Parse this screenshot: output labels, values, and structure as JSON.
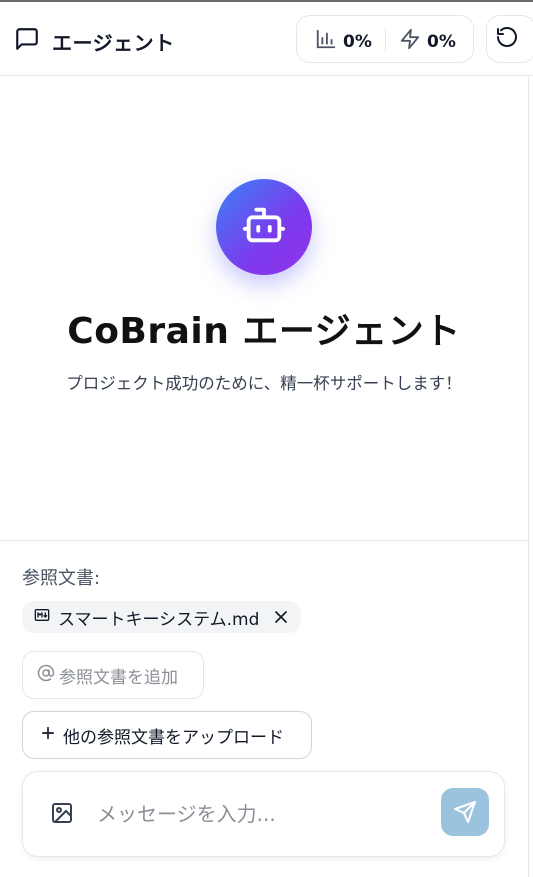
{
  "header": {
    "title": "エージェント",
    "stats": [
      {
        "icon": "bar-chart-icon",
        "value": "0%"
      },
      {
        "icon": "lightning-icon",
        "value": "0%"
      }
    ],
    "reset_icon": "reset-icon"
  },
  "hero": {
    "avatar_icon": "robot-icon",
    "title": "CoBrain エージェント",
    "subtitle": "プロジェクト成功のために、精一杯サポートします！"
  },
  "references": {
    "label": "参照文書:",
    "documents": [
      {
        "name": "スマートキーシステム.md",
        "icon": "markdown-icon"
      }
    ],
    "add_label": "参照文書を追加",
    "upload_label": "他の参照文書をアップロード"
  },
  "composer": {
    "placeholder": "メッセージを入力...",
    "image_icon": "image-icon",
    "send_icon": "send-icon"
  },
  "colors": {
    "avatar_gradient_start": "#3b82f6",
    "avatar_gradient_end": "#9333ea",
    "send_button": "#9cc3dd"
  }
}
